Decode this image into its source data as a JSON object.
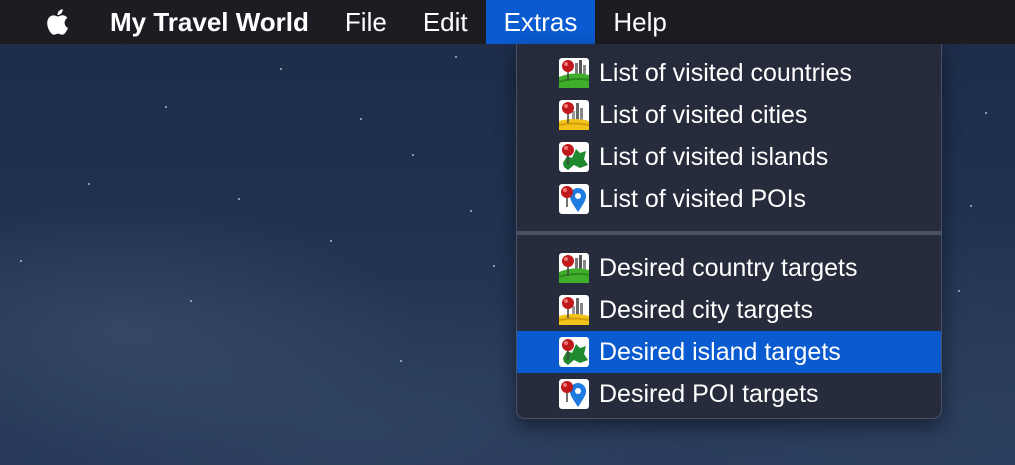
{
  "menubar": {
    "apple_icon": "apple-logo-icon",
    "app_name": "My Travel World",
    "menus": [
      "File",
      "Edit",
      "Extras",
      "Help"
    ],
    "active_menu": "Extras"
  },
  "dropdown": {
    "groups": [
      [
        {
          "label": "List of visited countries",
          "icon": "country-pin-icon"
        },
        {
          "label": "List of visited cities",
          "icon": "city-pin-icon"
        },
        {
          "label": "List of visited islands",
          "icon": "island-pin-icon"
        },
        {
          "label": "List of visited POIs",
          "icon": "poi-pin-icon"
        }
      ],
      [
        {
          "label": "Desired country targets",
          "icon": "country-pin-icon"
        },
        {
          "label": "Desired city targets",
          "icon": "city-pin-icon"
        },
        {
          "label": "Desired island targets",
          "icon": "island-pin-icon"
        },
        {
          "label": "Desired POI targets",
          "icon": "poi-pin-icon"
        }
      ]
    ],
    "highlighted_item": "Desired island targets"
  },
  "colors": {
    "menubar_bg": "#1b1d22",
    "highlight": "#0a5bd0",
    "menu_bg": "#262c3a"
  }
}
